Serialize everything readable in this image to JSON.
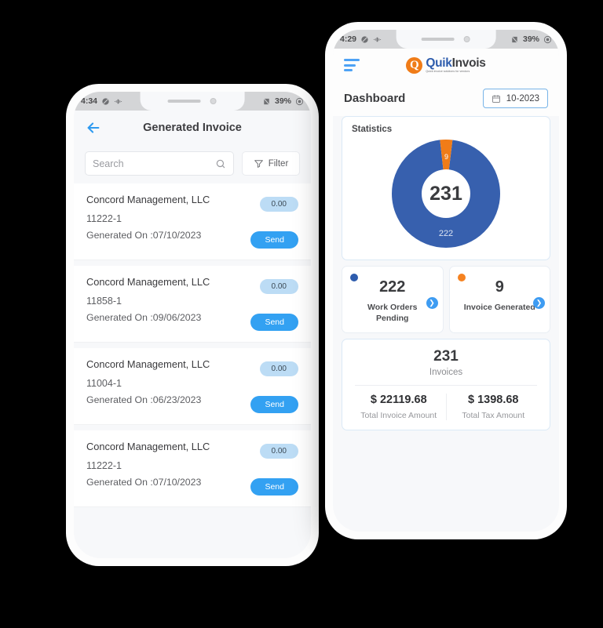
{
  "left_phone": {
    "status_bar": {
      "time": "4:34",
      "battery": "39%",
      "icons": [
        "circle-slash-icon",
        "vibrate-icon",
        "no-sim-icon",
        "battery-icon"
      ]
    },
    "header": {
      "back_icon": "arrow-left-icon",
      "title": "Generated Invoice"
    },
    "search": {
      "placeholder": "Search",
      "value": "",
      "icon": "search-icon"
    },
    "filter": {
      "label": "Filter",
      "icon": "funnel-icon"
    },
    "invoices": [
      {
        "name": "Concord Management, LLC",
        "number": "11222-1",
        "date": "Generated On :07/10/2023",
        "amount": "0.00",
        "action": "Send"
      },
      {
        "name": "Concord Management, LLC",
        "number": "11858-1",
        "date": "Generated On :09/06/2023",
        "amount": "0.00",
        "action": "Send"
      },
      {
        "name": "Concord Management, LLC",
        "number": "11004-1",
        "date": "Generated On :06/23/2023",
        "amount": "0.00",
        "action": "Send"
      },
      {
        "name": "Concord Management, LLC",
        "number": "11222-1",
        "date": "Generated On :07/10/2023",
        "amount": "0.00",
        "action": "Send"
      }
    ]
  },
  "right_phone": {
    "status_bar": {
      "time": "4:29",
      "battery": "39%",
      "icons": [
        "circle-slash-icon",
        "vibrate-icon",
        "no-sim-icon",
        "battery-icon"
      ]
    },
    "top_bar": {
      "menu_icon": "hamburger-menu-icon",
      "logo": {
        "mark": "Q",
        "part1": "Quik",
        "part2": "Invois",
        "tagline": "Quick invoice solutions for vendors"
      }
    },
    "dashboard": {
      "title": "Dashboard",
      "date_picker": {
        "icon": "calendar-icon",
        "value": "10-2023"
      }
    },
    "statistics": {
      "title": "Statistics"
    },
    "stat_cards": [
      {
        "dot_color": "#2d5cad",
        "value": "222",
        "label": "Work Orders Pending",
        "chevron": "chevron-right-icon"
      },
      {
        "dot_color": "#f58220",
        "value": "9",
        "label": "Invoice Generated",
        "chevron": "chevron-right-icon"
      }
    ],
    "summary": {
      "count": "231",
      "count_label": "Invoices",
      "invoice_amount": "$ 22119.68",
      "invoice_amount_label": "Total Invoice Amount",
      "tax_amount": "$ 1398.68",
      "tax_amount_label": "Total Tax Amount"
    }
  },
  "chart_data": {
    "type": "pie",
    "title": "Statistics",
    "labels": [
      "Work Orders Pending",
      "Invoice Generated"
    ],
    "values": [
      222,
      9
    ],
    "colors": [
      "#3760ae",
      "#f07c18"
    ],
    "center_label": "231",
    "slice_labels": [
      "222",
      "9"
    ],
    "total": 231,
    "legend": "none",
    "donut": true
  }
}
